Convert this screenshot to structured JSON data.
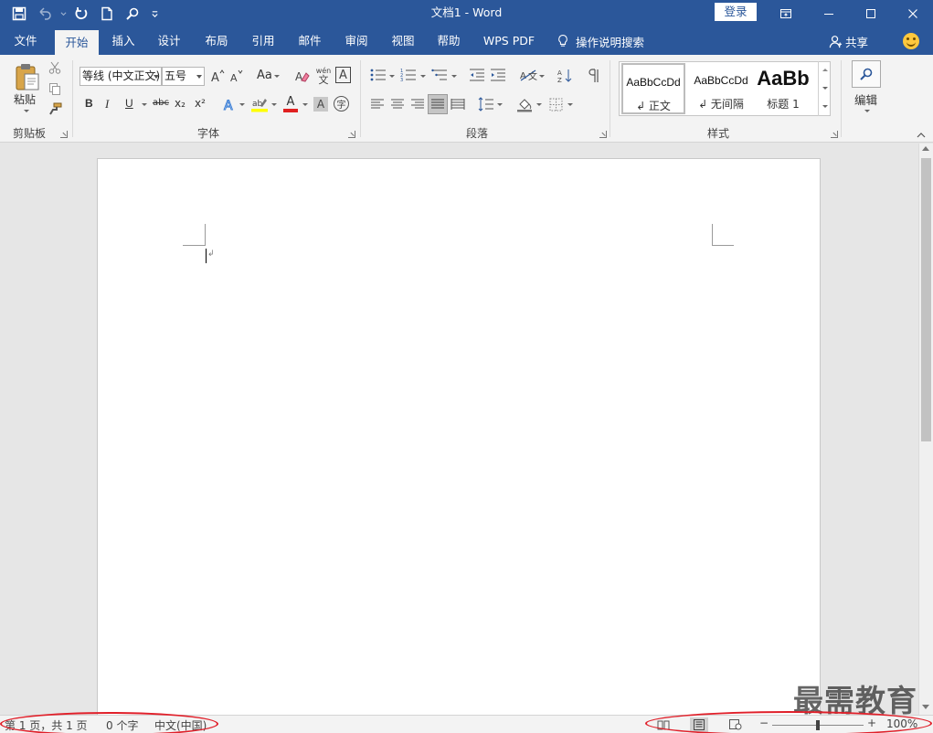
{
  "titlebar": {
    "title": "文档1  -  Word",
    "login_label": "登录"
  },
  "tabs": [
    "文件",
    "开始",
    "插入",
    "设计",
    "布局",
    "引用",
    "邮件",
    "审阅",
    "视图",
    "帮助",
    "WPS PDF"
  ],
  "active_tab": "开始",
  "tell_me": "操作说明搜索",
  "share_label": "共享",
  "ribbon": {
    "clipboard": {
      "paste_label": "粘贴",
      "group_label": "剪贴板"
    },
    "font": {
      "font_name": "等线 (中文正文)",
      "font_size": "五号",
      "case_label": "Aa",
      "bold": "B",
      "italic": "I",
      "underline": "U",
      "strike": "abc",
      "subscript": "x₂",
      "superscript": "x²",
      "phonetic_top": "wén",
      "phonetic_bottom": "文",
      "border_char": "A",
      "font_color_char": "A",
      "shading_char": "A",
      "enclose_char": "字",
      "group_label": "字体"
    },
    "paragraph": {
      "group_label": "段落"
    },
    "styles": {
      "items": [
        {
          "sample": "AaBbCcDd",
          "name": "↲ 正文"
        },
        {
          "sample": "AaBbCcDd",
          "name": "↲ 无间隔"
        },
        {
          "sample": "AaBb",
          "name": "标题 1"
        }
      ],
      "group_label": "样式"
    },
    "editing": {
      "label": "编辑"
    }
  },
  "statusbar": {
    "page_info": "第 1 页，共 1 页",
    "word_count": "0 个字",
    "language": "中文(中国)",
    "zoom_minus": "−",
    "zoom_plus": "+",
    "zoom_percent": "100%",
    "zoom_level": 1.0
  },
  "watermark": "最需教育",
  "colors": {
    "accent": "#2b579a",
    "highlight_circle": "#e0202a"
  }
}
